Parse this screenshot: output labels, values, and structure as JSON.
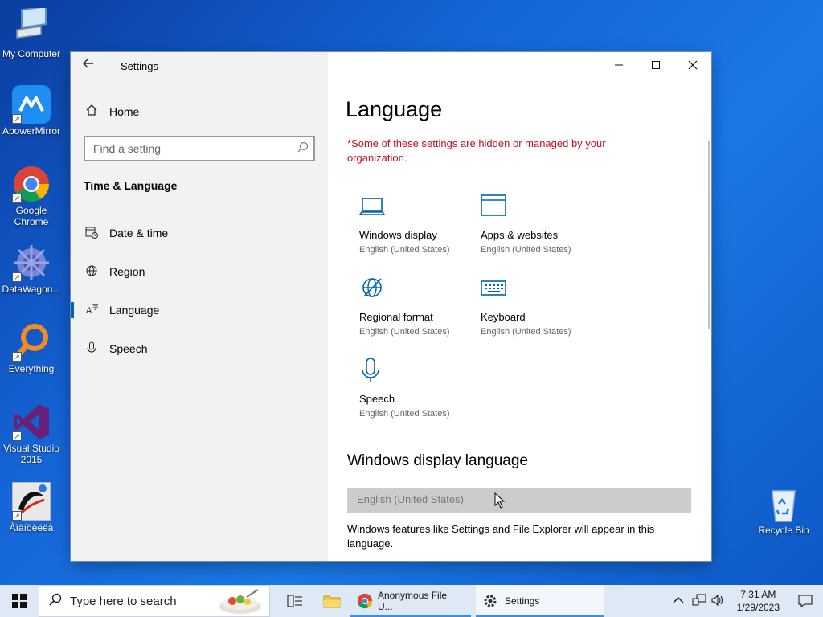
{
  "desktop": {
    "icons": [
      {
        "label": "My Computer",
        "icon": "computer-icon"
      },
      {
        "label": "ApowerMirror",
        "icon": "apowermirror-icon"
      },
      {
        "label": "Google Chrome",
        "icon": "chrome-icon"
      },
      {
        "label": "DataWagon...",
        "icon": "datawagon-icon"
      },
      {
        "label": "Everything",
        "icon": "everything-icon"
      },
      {
        "label": "Visual Studio 2015",
        "icon": "visual-studio-icon"
      },
      {
        "label": "Àìàíõèëëà",
        "icon": "app-shortcut-icon"
      },
      {
        "label": "Recycle Bin",
        "icon": "recycle-bin-icon"
      }
    ]
  },
  "window": {
    "title": "Settings",
    "sidebar": {
      "home": "Home",
      "search_placeholder": "Find a setting",
      "section": "Time & Language",
      "items": [
        {
          "label": "Date & time",
          "icon": "calendar-clock-icon"
        },
        {
          "label": "Region",
          "icon": "globe-icon"
        },
        {
          "label": "Language",
          "icon": "language-icon",
          "active": true
        },
        {
          "label": "Speech",
          "icon": "microphone-icon"
        }
      ]
    },
    "content": {
      "title": "Language",
      "warning": "*Some of these settings are hidden or managed by your organization.",
      "tiles": [
        {
          "name": "Windows display",
          "sub": "English (United States)",
          "icon": "laptop-icon"
        },
        {
          "name": "Apps & websites",
          "sub": "English (United States)",
          "icon": "window-icon"
        },
        {
          "name": "Regional format",
          "sub": "English (United States)",
          "icon": "globe-icon"
        },
        {
          "name": "Keyboard",
          "sub": "English (United States)",
          "icon": "keyboard-icon"
        },
        {
          "name": "Speech",
          "sub": "English (United States)",
          "icon": "microphone-icon"
        }
      ],
      "display_language_heading": "Windows display language",
      "display_language_value": "English (United States)",
      "display_language_desc": "Windows features like Settings and File Explorer will appear in this language."
    }
  },
  "taskbar": {
    "search_placeholder": "Type here to search",
    "apps": [
      {
        "label": "Anonymous File U...",
        "icon": "chrome-icon"
      },
      {
        "label": "Settings",
        "icon": "gear-icon"
      }
    ],
    "time": "7:31 AM",
    "date": "1/29/2023"
  },
  "colors": {
    "accent": "#0063b1",
    "warning": "#c50f1f",
    "taskbar": "#dfe9f5"
  }
}
